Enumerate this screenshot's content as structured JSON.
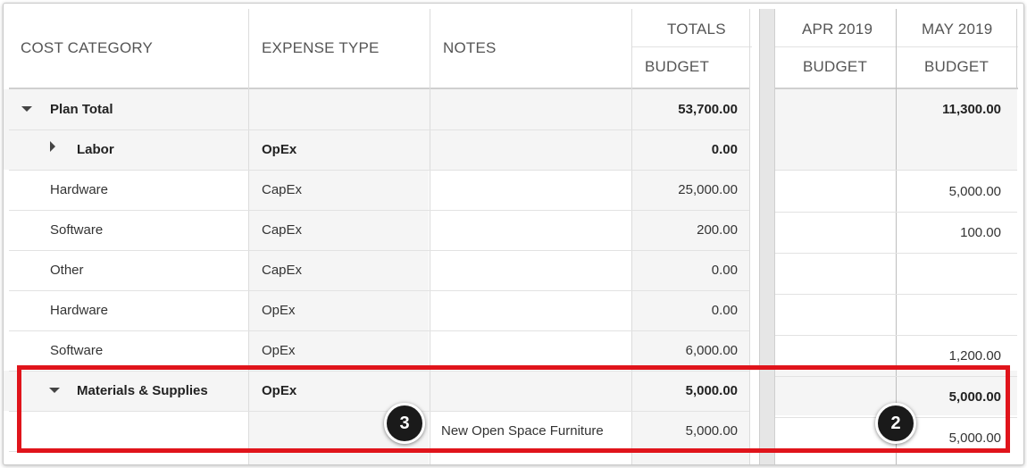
{
  "header": {
    "cost_category": "COST CATEGORY",
    "expense_type": "EXPENSE TYPE",
    "notes": "NOTES",
    "totals": "TOTALS",
    "totals_sub": "BUDGET",
    "apr": "APR 2019",
    "apr_sub": "BUDGET",
    "may": "MAY 2019",
    "may_sub": "BUDGET"
  },
  "rows": [
    {
      "category": "Plan Total",
      "expense": "",
      "notes": "",
      "total": "53,700.00",
      "apr": "",
      "may": "11,300.00"
    },
    {
      "category": "Labor",
      "expense": "OpEx",
      "notes": "",
      "total": "0.00",
      "apr": "",
      "may": ""
    },
    {
      "category": "Hardware",
      "expense": "CapEx",
      "notes": "",
      "total": "25,000.00",
      "apr": "",
      "may": "5,000.00"
    },
    {
      "category": "Software",
      "expense": "CapEx",
      "notes": "",
      "total": "200.00",
      "apr": "",
      "may": "100.00"
    },
    {
      "category": "Other",
      "expense": "CapEx",
      "notes": "",
      "total": "0.00",
      "apr": "",
      "may": ""
    },
    {
      "category": "Hardware",
      "expense": "OpEx",
      "notes": "",
      "total": "0.00",
      "apr": "",
      "may": ""
    },
    {
      "category": "Software",
      "expense": "OpEx",
      "notes": "",
      "total": "6,000.00",
      "apr": "",
      "may": "1,200.00"
    },
    {
      "category": "Materials & Supplies",
      "expense": "OpEx",
      "notes": "",
      "total": "5,000.00",
      "apr": "",
      "may": "5,000.00"
    },
    {
      "category": "",
      "expense": "",
      "notes": "New Open Space Furniture",
      "total": "5,000.00",
      "apr": "",
      "may": "5,000.00"
    }
  ],
  "callouts": {
    "notes_badge": "3",
    "may_badge": "2"
  },
  "colors": {
    "highlight": "#e0141b",
    "badge": "#1a1a1a"
  }
}
